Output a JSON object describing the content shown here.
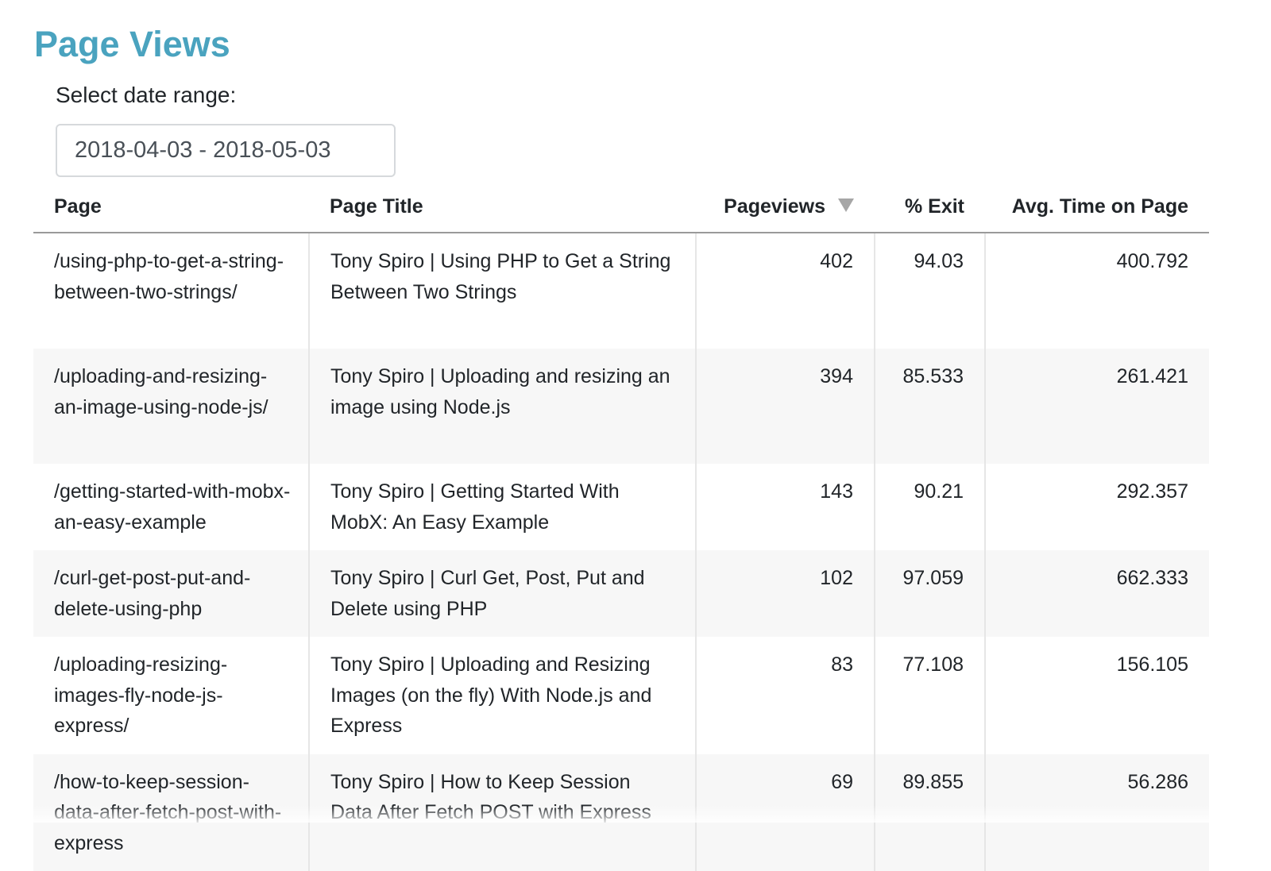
{
  "header": {
    "title": "Page Views"
  },
  "date_range": {
    "label": "Select date range:",
    "value": "2018-04-03 - 2018-05-03"
  },
  "table": {
    "columns": [
      "Page",
      "Page Title",
      "Pageviews",
      "% Exit",
      "Avg. Time on Page"
    ],
    "sort": {
      "column": "Pageviews",
      "direction": "descending",
      "icon": "sort-descending-icon"
    },
    "rows": [
      {
        "page": "/using-php-to-get-a-string-between-two-strings/",
        "page_title": "Tony Spiro | Using PHP to Get a String Between Two Strings",
        "pageviews": "402",
        "exit": "94.03",
        "avg_time": "400.792"
      },
      {
        "page": "/uploading-and-resizing-an-image-using-node-js/",
        "page_title": "Tony Spiro | Uploading and resizing an image using Node.js",
        "pageviews": "394",
        "exit": "85.533",
        "avg_time": "261.421"
      },
      {
        "page": "/getting-started-with-mobx-an-easy-example",
        "page_title": "Tony Spiro | Getting Started With MobX: An Easy Example",
        "pageviews": "143",
        "exit": "90.21",
        "avg_time": "292.357"
      },
      {
        "page": "/curl-get-post-put-and-delete-using-php",
        "page_title": "Tony Spiro | Curl Get, Post, Put and Delete using PHP",
        "pageviews": "102",
        "exit": "97.059",
        "avg_time": "662.333"
      },
      {
        "page": "/uploading-resizing-images-fly-node-js-express/",
        "page_title": "Tony Spiro | Uploading and Resizing Images (on the fly) With Node.js and Express",
        "pageviews": "83",
        "exit": "77.108",
        "avg_time": "156.105"
      },
      {
        "page": "/how-to-keep-session-data-after-fetch-post-with-express",
        "page_title": "Tony Spiro | How to Keep Session Data After Fetch POST with Express",
        "pageviews": "69",
        "exit": "89.855",
        "avg_time": "56.286"
      }
    ]
  },
  "colors": {
    "title": "#4aa3bf",
    "text": "#212529",
    "stripe": "#f7f7f7",
    "header_rule": "#9a9a9a"
  }
}
